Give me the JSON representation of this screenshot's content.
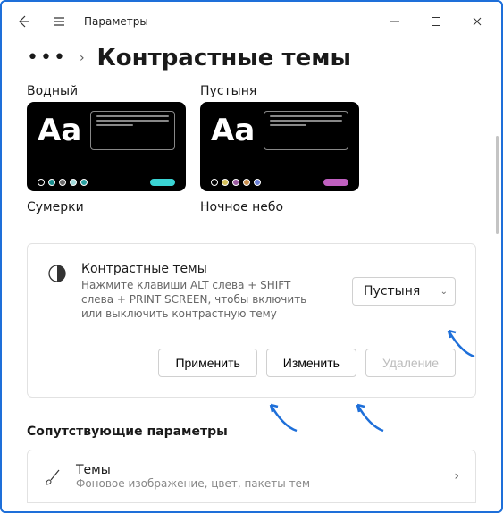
{
  "window": {
    "title": "Параметры"
  },
  "page": {
    "heading": "Контрастные темы"
  },
  "themes": [
    {
      "label": "Водный"
    },
    {
      "label": "Пустыня"
    },
    {
      "label": "Сумерки"
    },
    {
      "label": "Ночное небо"
    }
  ],
  "card": {
    "title": "Контрастные темы",
    "description": "Нажмите клавиши ALT слева + SHIFT слева + PRINT SCREEN, чтобы включить или выключить контрастную тему",
    "select_value": "Пустыня"
  },
  "buttons": {
    "apply": "Применить",
    "edit": "Изменить",
    "delete": "Удаление"
  },
  "related": {
    "heading": "Сопутствующие параметры",
    "item_title": "Темы",
    "item_sub": "Фоновое изображение, цвет, пакеты тем"
  }
}
